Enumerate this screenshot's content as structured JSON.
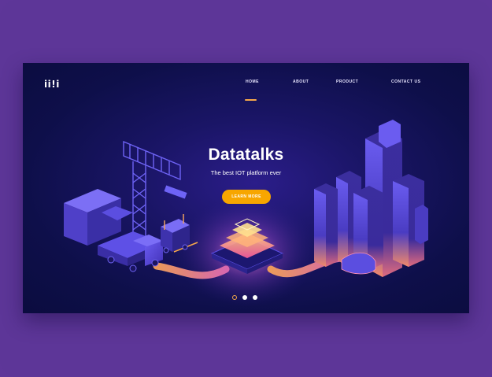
{
  "brand": {
    "logo_text": "ii!i"
  },
  "nav": {
    "items": [
      {
        "label": "HOME",
        "active": true
      },
      {
        "label": "ABOUT",
        "active": false
      },
      {
        "label": "PRODUCT",
        "active": false
      },
      {
        "label": "CONTACT US",
        "active": false
      }
    ]
  },
  "hero": {
    "title": "Datatalks",
    "subtitle": "The best IOT platform ever",
    "cta_label": "LEARN MORE"
  },
  "carousel": {
    "slide_count": 3,
    "active_index": 0
  },
  "colors": {
    "outer_background": "#5d3698",
    "page_background": "#0e0f4a",
    "accent": "#f7a600",
    "nav_underline": "#f7a84a",
    "glow": "#ff6fa8",
    "building_purple": "#5a4fd6"
  },
  "illustration": {
    "icons": [
      "crane-icon",
      "truck-icon",
      "forklift-icon",
      "server-chip-icon",
      "city-skyscrapers-icon"
    ]
  }
}
